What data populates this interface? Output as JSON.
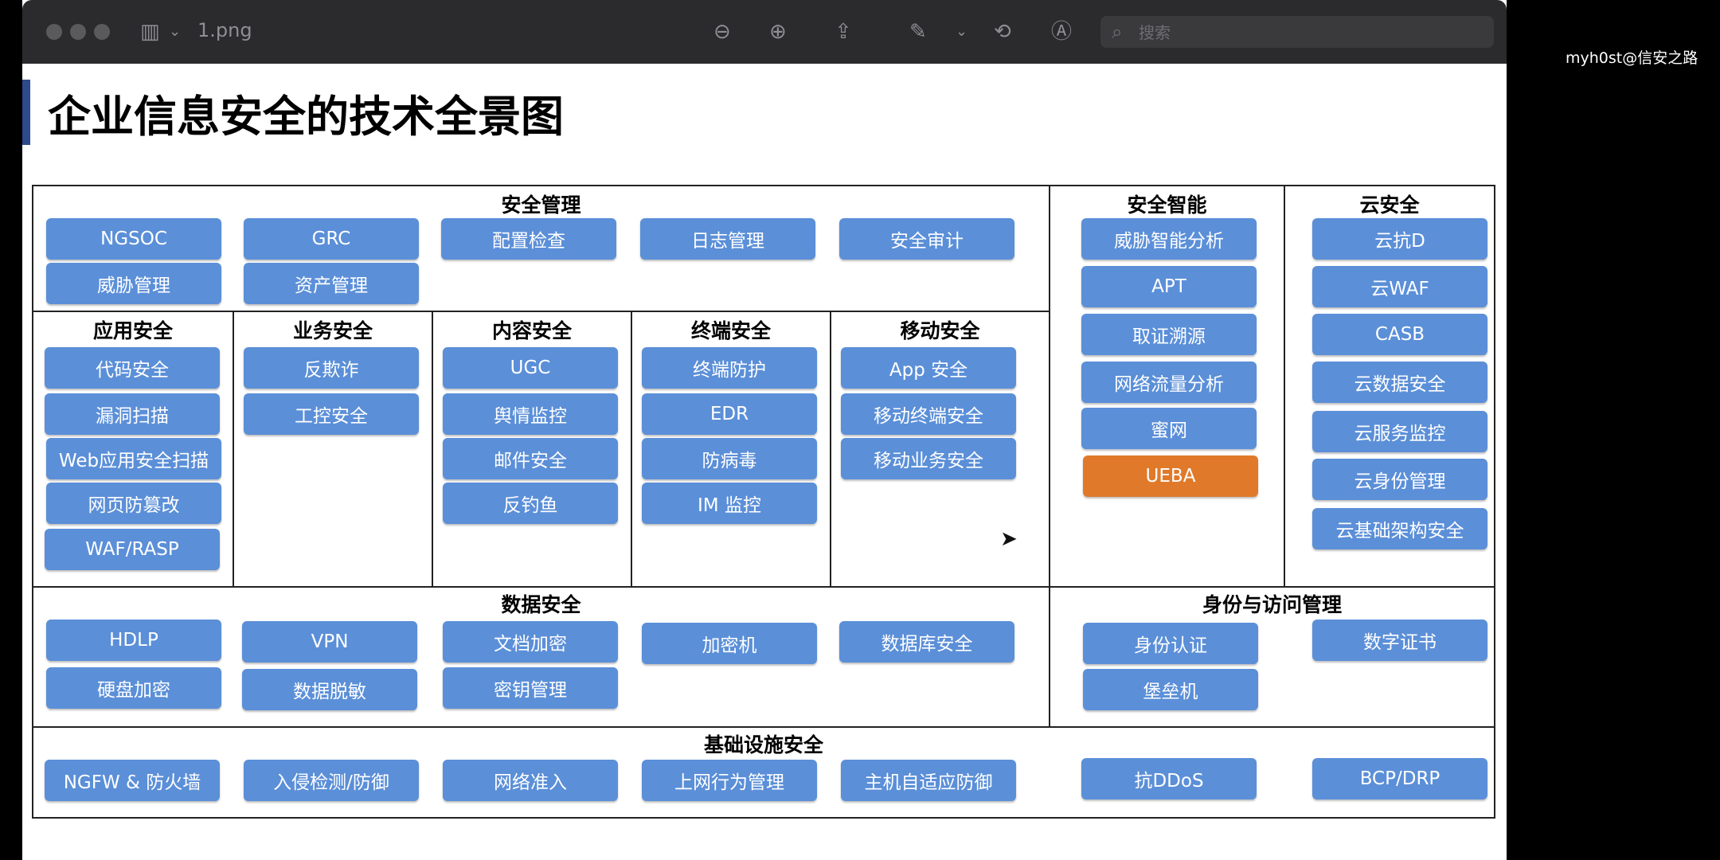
{
  "toolbar": {
    "filename": "1.png",
    "search_placeholder": "搜索"
  },
  "watermark": "myh0st@信安之路",
  "page_title": "企业信息安全的技术全景图",
  "sections": {
    "security_management": {
      "title": "安全管理",
      "items": [
        "NGSOC",
        "GRC",
        "配置检查",
        "日志管理",
        "安全审计",
        "威胁管理",
        "资产管理"
      ]
    },
    "security_intelligence": {
      "title": "安全智能",
      "items": [
        "威胁智能分析",
        "APT",
        "取证溯源",
        "网络流量分析",
        "蜜网",
        "UEBA"
      ]
    },
    "cloud_security": {
      "title": "云安全",
      "items": [
        "云抗D",
        "云WAF",
        "CASB",
        "云数据安全",
        "云服务监控",
        "云身份管理",
        "云基础架构安全"
      ]
    },
    "app_security": {
      "title": "应用安全",
      "items": [
        "代码安全",
        "漏洞扫描",
        "Web应用安全扫描",
        "网页防篡改",
        "WAF/RASP"
      ]
    },
    "business_security": {
      "title": "业务安全",
      "items": [
        "反欺诈",
        "工控安全"
      ]
    },
    "content_security": {
      "title": "内容安全",
      "items": [
        "UGC",
        "舆情监控",
        "邮件安全",
        "反钓鱼"
      ]
    },
    "endpoint_security": {
      "title": "终端安全",
      "items": [
        "终端防护",
        "EDR",
        "防病毒",
        "IM  监控"
      ]
    },
    "mobile_security": {
      "title": "移动安全",
      "items": [
        "App 安全",
        "移动终端安全",
        "移动业务安全"
      ]
    },
    "data_security": {
      "title": "数据安全",
      "items": [
        "HDLP",
        "VPN",
        "文档加密",
        "加密机",
        "数据库安全",
        "硬盘加密",
        "数据脱敏",
        "密钥管理"
      ]
    },
    "identity_access": {
      "title": "身份与访问管理",
      "items": [
        "身份认证",
        "数字证书",
        "堡垒机"
      ]
    },
    "infrastructure": {
      "title": "基础设施安全",
      "items": [
        "NGFW & 防火墙",
        "入侵检测/防御",
        "网络准入",
        "上网行为管理",
        "主机自适应防御",
        "抗DDoS",
        "BCP/DRP"
      ]
    }
  },
  "colors": {
    "box_blue": "#5b8fd8",
    "highlight_orange": "#e07a2a",
    "title_accent": "#2c4a8c"
  }
}
